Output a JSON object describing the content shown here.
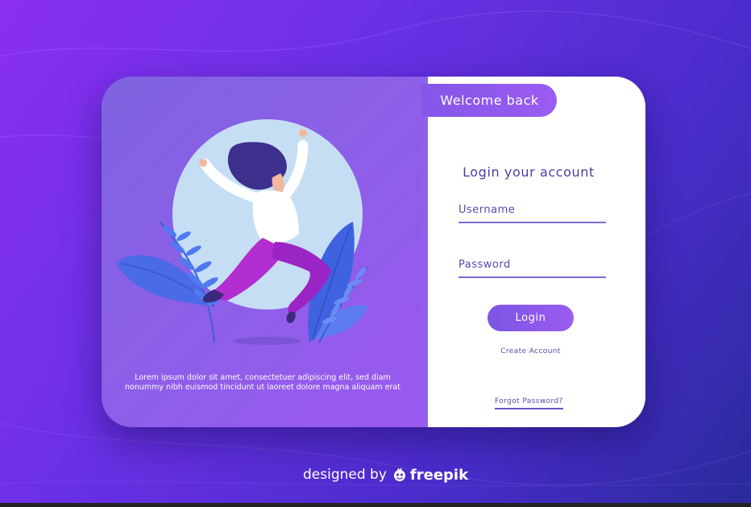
{
  "welcome_label": "Welcome back",
  "login_title": "Login your account",
  "form": {
    "username_label": "Username",
    "password_label": "Password",
    "login_button": "Login",
    "create_account": "Create Account",
    "forgot_password": "Forgot Password?"
  },
  "lorem_text": "Lorem ipsum dolor sit amet, consectetuer adipiscing elit, sed diam nonummy nibh euismod tincidunt ut laoreet dolore magna aliquam erat",
  "credit": {
    "designed_by": "designed by",
    "brand": "freepik"
  },
  "icons": {
    "illustration": "woman-jumping-with-leaves-illustration",
    "brand_logo": "freepik-logo-icon"
  },
  "colors": {
    "accent": "#8456e8",
    "title_text": "#4a3fa0",
    "underline": "#7b6ad6"
  }
}
